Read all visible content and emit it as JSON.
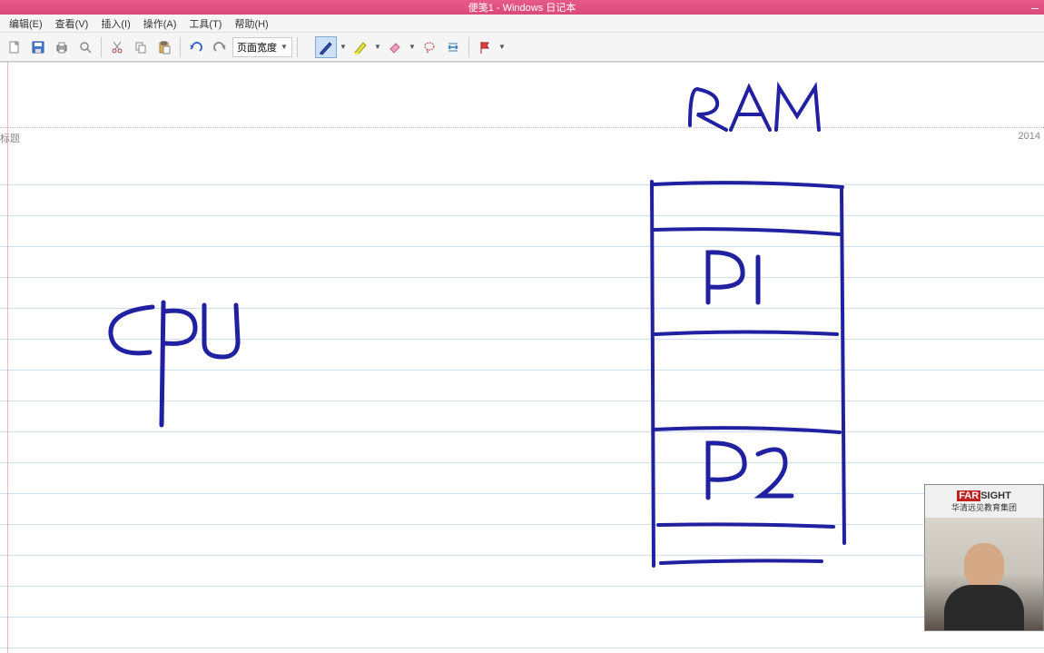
{
  "window": {
    "title": "便笺1 - Windows 日记本"
  },
  "menu": {
    "edit": "编辑(E)",
    "view": "查看(V)",
    "insert": "插入(I)",
    "actions": "操作(A)",
    "tools": "工具(T)",
    "help": "帮助(H)"
  },
  "toolbar": {
    "zoom_label": "页面宽度"
  },
  "page": {
    "title_placeholder": "标题",
    "date": "2014"
  },
  "ink": {
    "label_ram": "RAM",
    "label_cpu": "CPU",
    "label_p1": "P1",
    "label_p2": "P2"
  },
  "webcam": {
    "logo_a": "FAR",
    "logo_b": "SIGHT",
    "subtitle": "华清远见教育集团"
  }
}
